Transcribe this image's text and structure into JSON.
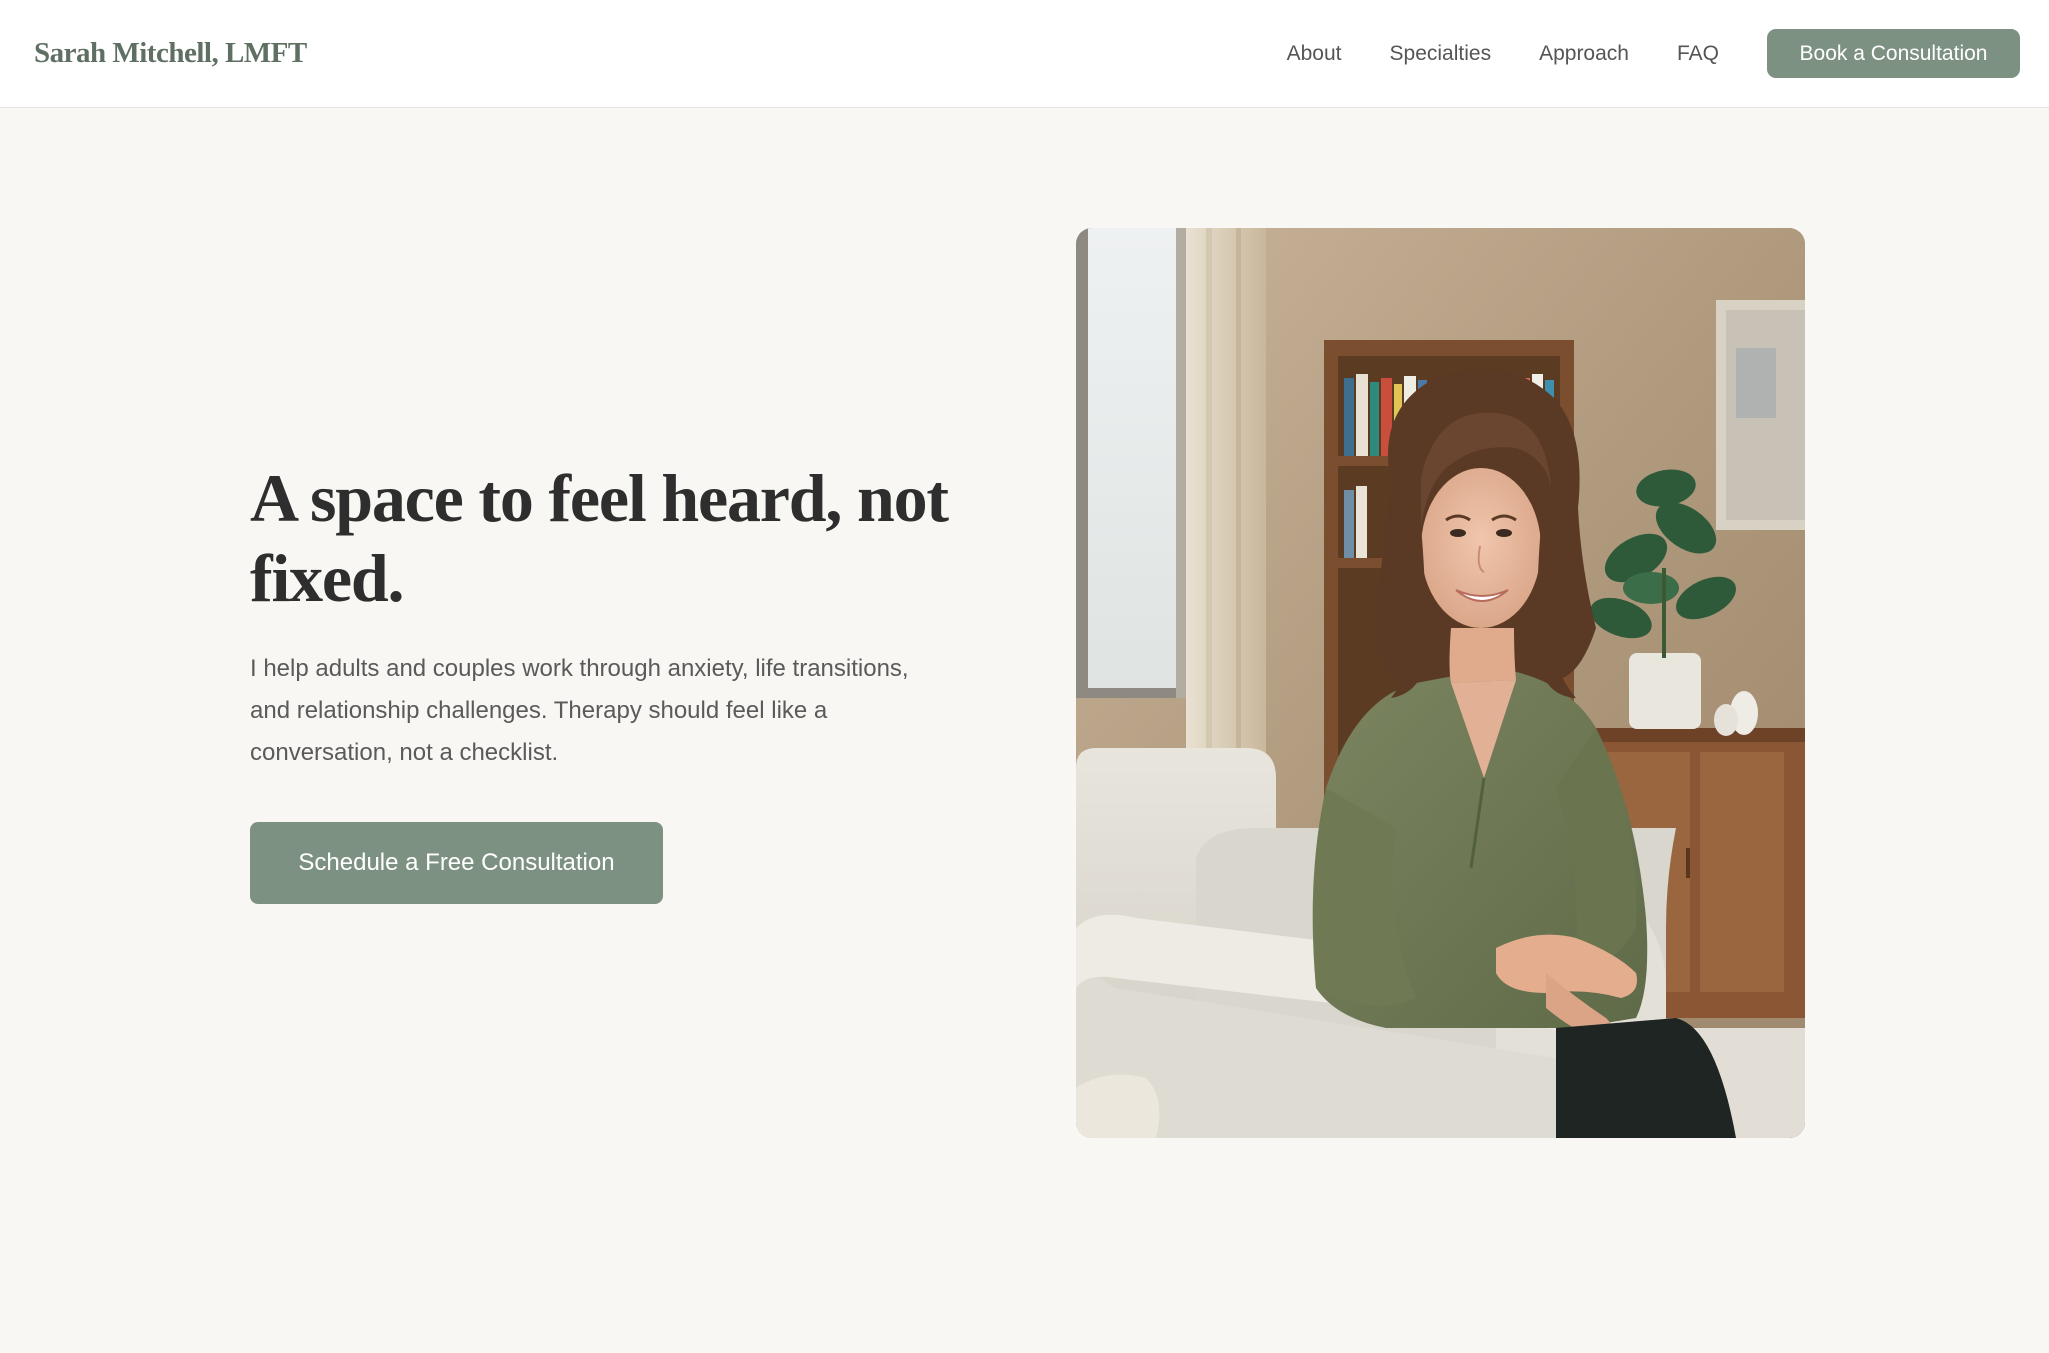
{
  "header": {
    "logo": "Sarah Mitchell, LMFT",
    "nav": [
      "About",
      "Specialties",
      "Approach",
      "FAQ"
    ],
    "cta_label": "Book a Consultation"
  },
  "hero": {
    "title": "A space to feel heard, not fixed.",
    "subtitle": "I help adults and couples work through anxiety, life transitions, and relationship challenges. Therapy should feel like a conversation, not a checklist.",
    "cta_label": "Schedule a Free Consultation"
  },
  "colors": {
    "accent": "#7d9182",
    "logo": "#5f6f62",
    "background": "#f8f7f4",
    "heading": "#2e2e2e"
  }
}
